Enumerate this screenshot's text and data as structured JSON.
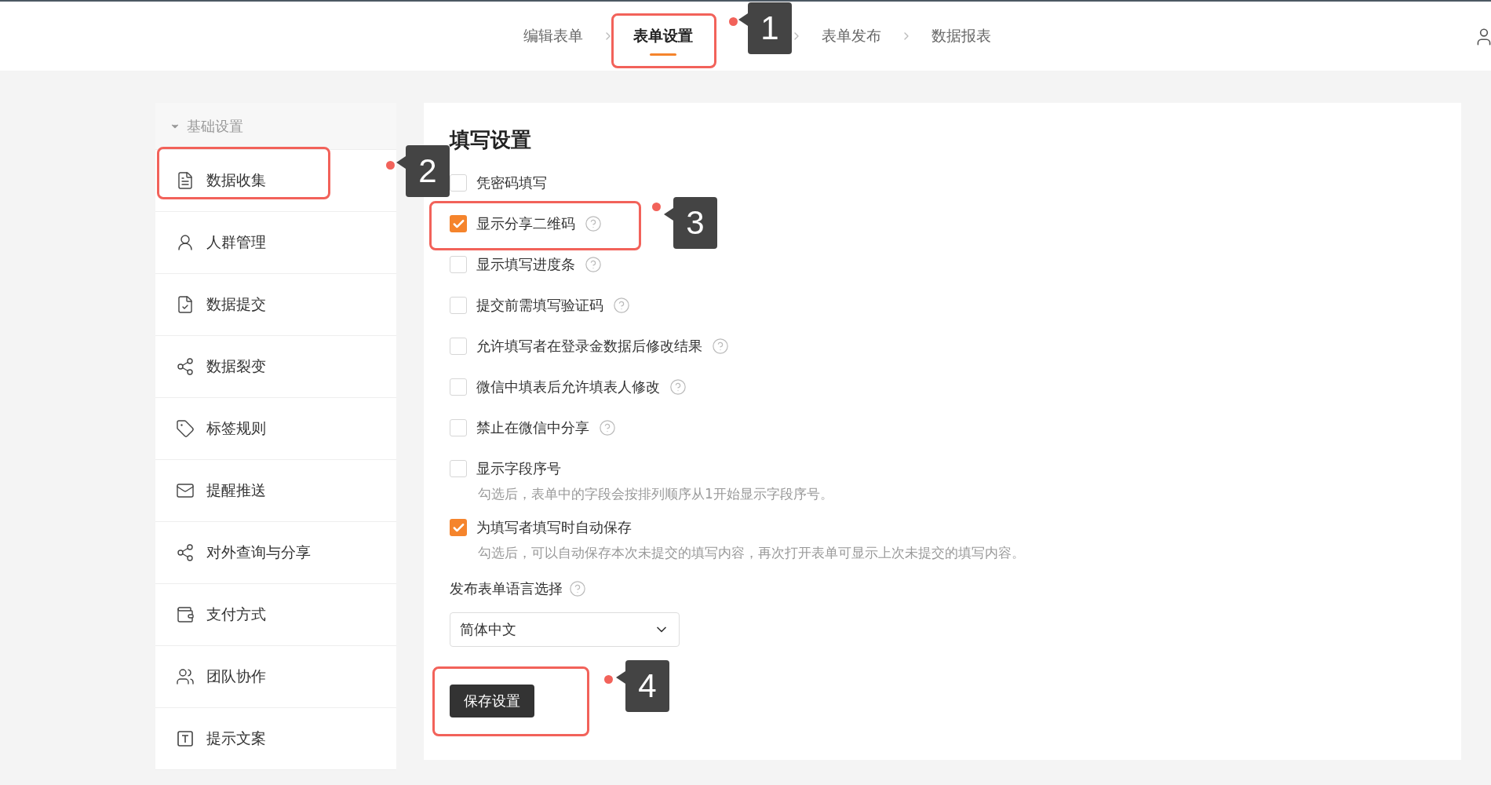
{
  "steps": [
    {
      "label": "编辑表单",
      "selected": false
    },
    {
      "label": "表单设置",
      "selected": true,
      "annotation": "1"
    },
    {
      "label": "表单发布",
      "selected": false
    },
    {
      "label": "数据报表",
      "selected": false
    }
  ],
  "sidebar": {
    "section": {
      "label": "基础设置",
      "expanded": true
    },
    "items": [
      {
        "label": "数据收集",
        "annotation": "2"
      },
      {
        "label": "人群管理"
      },
      {
        "label": "数据提交"
      },
      {
        "label": "数据裂变"
      },
      {
        "label": "标签规则"
      },
      {
        "label": "提醒推送"
      },
      {
        "label": "对外查询与分享"
      },
      {
        "label": "支付方式"
      },
      {
        "label": "团队协作"
      },
      {
        "label": "提示文案"
      }
    ]
  },
  "panel": {
    "title": "填写设置",
    "options": [
      {
        "label": "凭密码填写",
        "checked": false,
        "help": false
      },
      {
        "label": "显示分享二维码",
        "checked": true,
        "help": true,
        "annotation": "3"
      },
      {
        "label": "显示填写进度条",
        "checked": false,
        "help": true
      },
      {
        "label": "提交前需填写验证码",
        "checked": false,
        "help": true
      },
      {
        "label": "允许填写者在登录金数据后修改结果",
        "checked": false,
        "help": true
      },
      {
        "label": "微信中填表后允许填表人修改",
        "checked": false,
        "help": true
      },
      {
        "label": "禁止在微信中分享",
        "checked": false,
        "help": true
      },
      {
        "label": "显示字段序号",
        "checked": false,
        "help": false,
        "hint": "勾选后，表单中的字段会按排列顺序从1开始显示字段序号。"
      },
      {
        "label": "为填写者填写时自动保存",
        "checked": true,
        "help": false,
        "hint": "勾选后，可以自动保存本次未提交的填写内容，再次打开表单可显示上次未提交的填写内容。"
      }
    ],
    "language": {
      "label": "发布表单语言选择",
      "help": true,
      "value": "简体中文"
    },
    "save_button": {
      "label": "保存设置",
      "annotation": "4"
    }
  }
}
